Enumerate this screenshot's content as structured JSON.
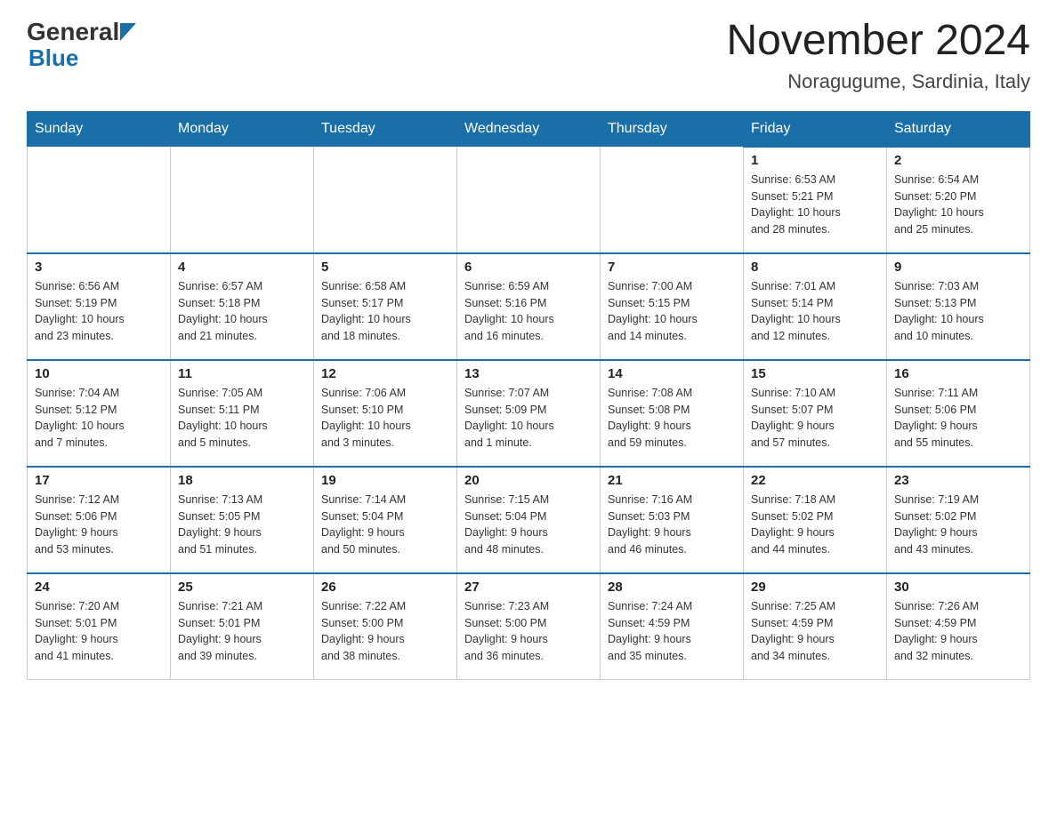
{
  "header": {
    "month_title": "November 2024",
    "location": "Noragugume, Sardinia, Italy"
  },
  "weekdays": [
    "Sunday",
    "Monday",
    "Tuesday",
    "Wednesday",
    "Thursday",
    "Friday",
    "Saturday"
  ],
  "weeks": [
    [
      {
        "day": "",
        "info": ""
      },
      {
        "day": "",
        "info": ""
      },
      {
        "day": "",
        "info": ""
      },
      {
        "day": "",
        "info": ""
      },
      {
        "day": "",
        "info": ""
      },
      {
        "day": "1",
        "info": "Sunrise: 6:53 AM\nSunset: 5:21 PM\nDaylight: 10 hours\nand 28 minutes."
      },
      {
        "day": "2",
        "info": "Sunrise: 6:54 AM\nSunset: 5:20 PM\nDaylight: 10 hours\nand 25 minutes."
      }
    ],
    [
      {
        "day": "3",
        "info": "Sunrise: 6:56 AM\nSunset: 5:19 PM\nDaylight: 10 hours\nand 23 minutes."
      },
      {
        "day": "4",
        "info": "Sunrise: 6:57 AM\nSunset: 5:18 PM\nDaylight: 10 hours\nand 21 minutes."
      },
      {
        "day": "5",
        "info": "Sunrise: 6:58 AM\nSunset: 5:17 PM\nDaylight: 10 hours\nand 18 minutes."
      },
      {
        "day": "6",
        "info": "Sunrise: 6:59 AM\nSunset: 5:16 PM\nDaylight: 10 hours\nand 16 minutes."
      },
      {
        "day": "7",
        "info": "Sunrise: 7:00 AM\nSunset: 5:15 PM\nDaylight: 10 hours\nand 14 minutes."
      },
      {
        "day": "8",
        "info": "Sunrise: 7:01 AM\nSunset: 5:14 PM\nDaylight: 10 hours\nand 12 minutes."
      },
      {
        "day": "9",
        "info": "Sunrise: 7:03 AM\nSunset: 5:13 PM\nDaylight: 10 hours\nand 10 minutes."
      }
    ],
    [
      {
        "day": "10",
        "info": "Sunrise: 7:04 AM\nSunset: 5:12 PM\nDaylight: 10 hours\nand 7 minutes."
      },
      {
        "day": "11",
        "info": "Sunrise: 7:05 AM\nSunset: 5:11 PM\nDaylight: 10 hours\nand 5 minutes."
      },
      {
        "day": "12",
        "info": "Sunrise: 7:06 AM\nSunset: 5:10 PM\nDaylight: 10 hours\nand 3 minutes."
      },
      {
        "day": "13",
        "info": "Sunrise: 7:07 AM\nSunset: 5:09 PM\nDaylight: 10 hours\nand 1 minute."
      },
      {
        "day": "14",
        "info": "Sunrise: 7:08 AM\nSunset: 5:08 PM\nDaylight: 9 hours\nand 59 minutes."
      },
      {
        "day": "15",
        "info": "Sunrise: 7:10 AM\nSunset: 5:07 PM\nDaylight: 9 hours\nand 57 minutes."
      },
      {
        "day": "16",
        "info": "Sunrise: 7:11 AM\nSunset: 5:06 PM\nDaylight: 9 hours\nand 55 minutes."
      }
    ],
    [
      {
        "day": "17",
        "info": "Sunrise: 7:12 AM\nSunset: 5:06 PM\nDaylight: 9 hours\nand 53 minutes."
      },
      {
        "day": "18",
        "info": "Sunrise: 7:13 AM\nSunset: 5:05 PM\nDaylight: 9 hours\nand 51 minutes."
      },
      {
        "day": "19",
        "info": "Sunrise: 7:14 AM\nSunset: 5:04 PM\nDaylight: 9 hours\nand 50 minutes."
      },
      {
        "day": "20",
        "info": "Sunrise: 7:15 AM\nSunset: 5:04 PM\nDaylight: 9 hours\nand 48 minutes."
      },
      {
        "day": "21",
        "info": "Sunrise: 7:16 AM\nSunset: 5:03 PM\nDaylight: 9 hours\nand 46 minutes."
      },
      {
        "day": "22",
        "info": "Sunrise: 7:18 AM\nSunset: 5:02 PM\nDaylight: 9 hours\nand 44 minutes."
      },
      {
        "day": "23",
        "info": "Sunrise: 7:19 AM\nSunset: 5:02 PM\nDaylight: 9 hours\nand 43 minutes."
      }
    ],
    [
      {
        "day": "24",
        "info": "Sunrise: 7:20 AM\nSunset: 5:01 PM\nDaylight: 9 hours\nand 41 minutes."
      },
      {
        "day": "25",
        "info": "Sunrise: 7:21 AM\nSunset: 5:01 PM\nDaylight: 9 hours\nand 39 minutes."
      },
      {
        "day": "26",
        "info": "Sunrise: 7:22 AM\nSunset: 5:00 PM\nDaylight: 9 hours\nand 38 minutes."
      },
      {
        "day": "27",
        "info": "Sunrise: 7:23 AM\nSunset: 5:00 PM\nDaylight: 9 hours\nand 36 minutes."
      },
      {
        "day": "28",
        "info": "Sunrise: 7:24 AM\nSunset: 4:59 PM\nDaylight: 9 hours\nand 35 minutes."
      },
      {
        "day": "29",
        "info": "Sunrise: 7:25 AM\nSunset: 4:59 PM\nDaylight: 9 hours\nand 34 minutes."
      },
      {
        "day": "30",
        "info": "Sunrise: 7:26 AM\nSunset: 4:59 PM\nDaylight: 9 hours\nand 32 minutes."
      }
    ]
  ]
}
